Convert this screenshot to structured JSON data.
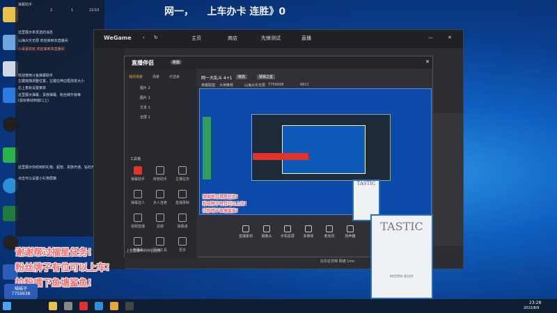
{
  "headline": "网一，    上车办卡 连胜》0",
  "chat": {
    "title": "弹幕助手",
    "stat1": "2",
    "stat2": "1",
    "stat3": "22/10",
    "lines": [
      "这里展示未发送的消息",
      "山海大乐无限   欢迎来到本直播间",
      "小哥喜欢玩  欢迎来到本直播间",
      "欢迎使用斗鱼弹幕助手",
      "左键拖拽调整位置，左键拉伸边框改变大小",
      "右上角有设置菜单",
      "这里展示弹幕，贵族弹幕、粉丝牌升级等",
      "(鼠标移动到窗口上)",
      "这里展示你收到的礼物、超管、贵族开通、钻石开通",
      "点击可以设置小礼物屏蔽"
    ]
  },
  "wegame": {
    "logo": "WeGame",
    "nav": [
      "主页",
      "商店",
      "先锋测试",
      "直播"
    ]
  },
  "zb": {
    "logo": "直播伴侣",
    "badge": "新版",
    "tabs": [
      "我的场景",
      "场景",
      "可选来"
    ],
    "layers": [
      "图片 2",
      "图片 1",
      "文本 1",
      "全屏 1"
    ],
    "room_title": "网一大乱斗 4+1",
    "room_edit": "修改",
    "room_btn": "猜猜之星",
    "room_cat": "英雄联盟",
    "room_sub": "大神推荐",
    "room_id": "山海大乐无限",
    "room_num": "7759938",
    "hot": "6811",
    "tools_title": "工具箱",
    "tools": [
      "弹幕助手",
      "房管助手",
      "主播任务",
      "弹幕选人",
      "多人连麦",
      "直播录制",
      "视频直播",
      "滤镜",
      "弹幕通",
      "直播间",
      "添加工具",
      "更多"
    ],
    "warn": "上告直播中的伴侣应用",
    "bottom": [
      "直播素材",
      "摄像头",
      "手机投屏",
      "多媒体",
      "麦克风",
      "扬声器"
    ],
    "volume": "6811",
    "footer": "比尔达沃特 网通 1ms"
  },
  "banners": {
    "line1": "谢谢帮过福星任务!",
    "line2": "粉丝牌子有位可以上车!",
    "line3": "拉粉喂下鱼塘鲨鱼!",
    "overlay1": "谢谢帮过福星任务!",
    "overlay2": "粉丝牌子有位可以上车!",
    "overlay3": "拉粉喂下鱼塘鲨鱼!"
  },
  "streamer_badge": {
    "name": "喵喵子",
    "id": "7759938"
  },
  "photo_text": {
    "big": "TASTIC",
    "small": "MISTER BODY"
  },
  "taskbar": {
    "time": "23:28",
    "date": "2022/8/9"
  }
}
